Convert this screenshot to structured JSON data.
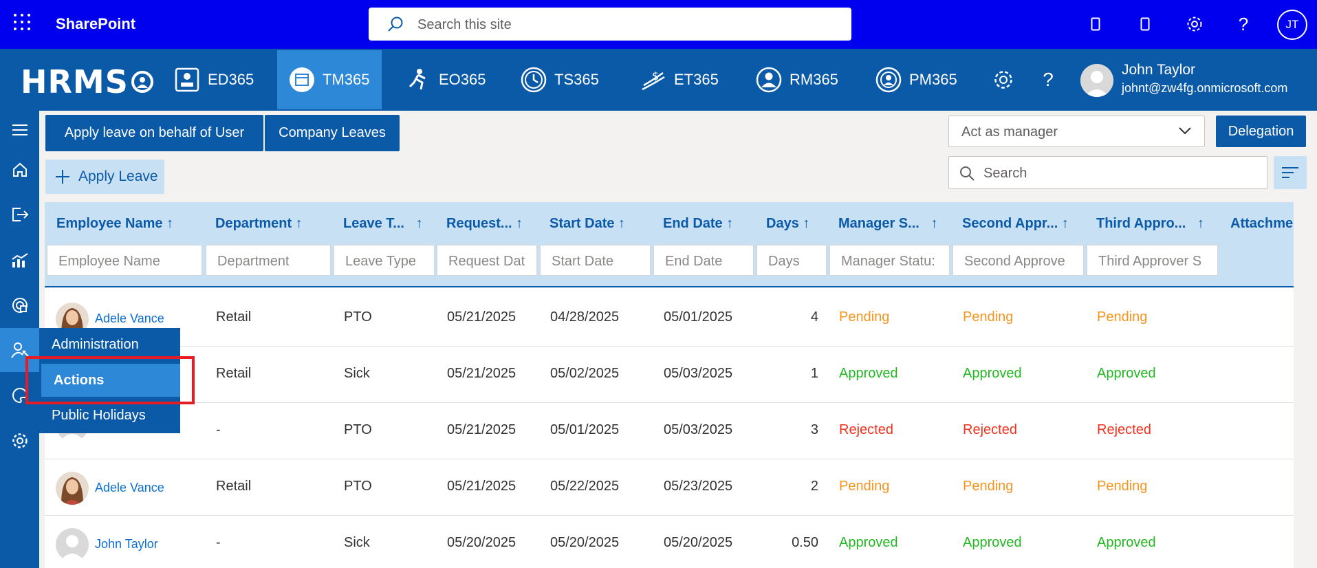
{
  "suite": {
    "app_name": "SharePoint",
    "search_placeholder": "Search this site",
    "user_initials": "JT"
  },
  "header": {
    "logo_text": "HRMS",
    "tabs": [
      {
        "label": "ED365",
        "icon": "employee-directory-icon"
      },
      {
        "label": "TM365",
        "icon": "calendar-icon"
      },
      {
        "label": "EO365",
        "icon": "onboarding-icon"
      },
      {
        "label": "TS365",
        "icon": "clock-icon"
      },
      {
        "label": "ET365",
        "icon": "expense-icon"
      },
      {
        "label": "RM365",
        "icon": "recruitment-icon"
      },
      {
        "label": "PM365",
        "icon": "performance-icon"
      }
    ],
    "active_tab": "TM365",
    "user": {
      "name": "John Taylor",
      "email": "johnt@zw4fg.onmicrosoft.com"
    }
  },
  "sidebar": {
    "items": [
      "menu-icon",
      "home-icon",
      "leave-icon",
      "reports-icon",
      "dashboard-icon",
      "user-settings-icon",
      "palette-icon",
      "settings-icon"
    ]
  },
  "flyout": {
    "items": [
      {
        "label": "Administration"
      },
      {
        "label": "Actions"
      },
      {
        "label": "Public Holidays"
      }
    ],
    "active": "Actions"
  },
  "toolbar": {
    "apply_behalf_label": "Apply leave on behalf of User",
    "company_leaves_label": "Company Leaves",
    "apply_leave_label": "Apply Leave",
    "act_as_placeholder": "Act as manager",
    "delegation_label": "Delegation",
    "search_placeholder": "Search"
  },
  "grid": {
    "columns": [
      {
        "label": "Employee Name",
        "filter": "Employee Name"
      },
      {
        "label": "Department",
        "filter": "Department"
      },
      {
        "label": "Leave T...",
        "filter": "Leave Type"
      },
      {
        "label": "Request...",
        "filter": "Request Dat"
      },
      {
        "label": "Start Date",
        "filter": "Start Date"
      },
      {
        "label": "End Date",
        "filter": "End Date"
      },
      {
        "label": "Days",
        "filter": "Days"
      },
      {
        "label": "Manager S...",
        "filter": "Manager Statu:"
      },
      {
        "label": "Second Appr...",
        "filter": "Second Approve"
      },
      {
        "label": "Third Appro...",
        "filter": "Third Approver S"
      },
      {
        "label": "Attachme",
        "filter": ""
      }
    ],
    "sort_arrow": "↑",
    "rows": [
      {
        "name": "Adele Vance",
        "avatar": "photo",
        "department": "Retail",
        "leave_type": "PTO",
        "request_date": "05/21/2025",
        "start_date": "04/28/2025",
        "end_date": "05/01/2025",
        "days": "4",
        "manager_status": "Pending",
        "second_status": "Pending",
        "third_status": "Pending"
      },
      {
        "name": "",
        "avatar": "none",
        "department": "Retail",
        "leave_type": "Sick",
        "request_date": "05/21/2025",
        "start_date": "05/02/2025",
        "end_date": "05/03/2025",
        "days": "1",
        "manager_status": "Approved",
        "second_status": "Approved",
        "third_status": "Approved"
      },
      {
        "name": "",
        "avatar": "none",
        "department": "-",
        "leave_type": "PTO",
        "request_date": "05/21/2025",
        "start_date": "05/01/2025",
        "end_date": "05/03/2025",
        "days": "3",
        "manager_status": "Rejected",
        "second_status": "Rejected",
        "third_status": "Rejected"
      },
      {
        "name": "Adele Vance",
        "avatar": "photo",
        "department": "Retail",
        "leave_type": "PTO",
        "request_date": "05/21/2025",
        "start_date": "05/22/2025",
        "end_date": "05/23/2025",
        "days": "2",
        "manager_status": "Pending",
        "second_status": "Pending",
        "third_status": "Pending"
      },
      {
        "name": "John Taylor",
        "avatar": "default",
        "department": "-",
        "leave_type": "Sick",
        "request_date": "05/20/2025",
        "start_date": "05/20/2025",
        "end_date": "05/20/2025",
        "days": "0.50",
        "manager_status": "Approved",
        "second_status": "Approved",
        "third_status": "Approved"
      }
    ]
  },
  "colors": {
    "suite_bar": "#0000ee",
    "brand": "#0b5aa8",
    "accent": "#2d88d8",
    "pending": "#f7941d",
    "approved": "#22b822",
    "rejected": "#f0331f"
  }
}
